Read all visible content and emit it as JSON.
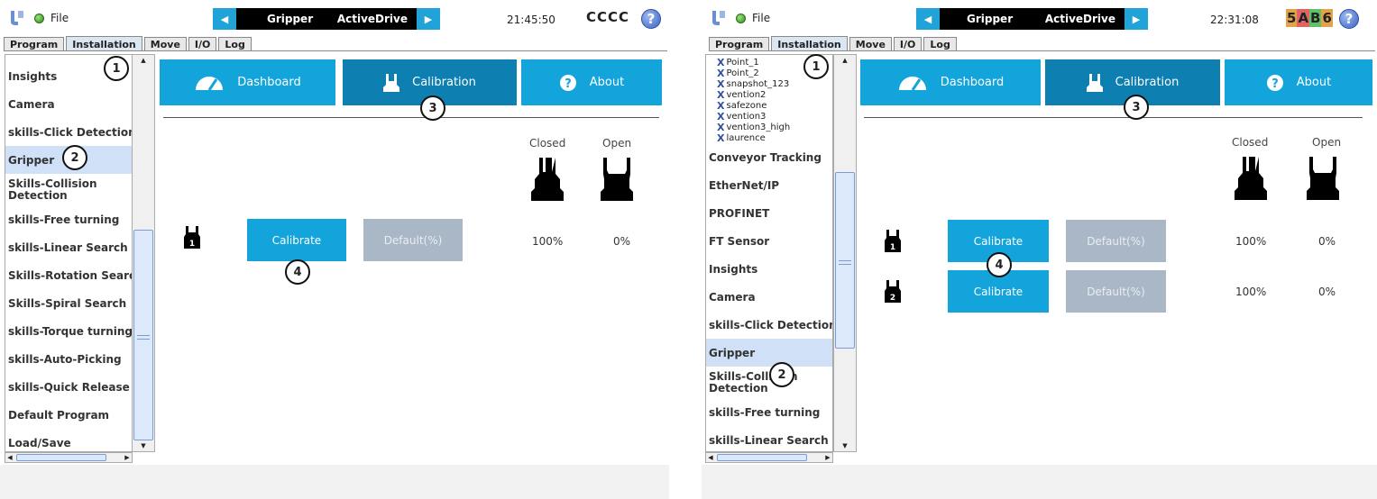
{
  "panels": [
    {
      "file_label": "File",
      "program_name": "Gripper",
      "mode_name": "ActiveDrive",
      "clock": "21:45:50",
      "robot_id": "CCCC",
      "robot_id_parts": [],
      "tabs": [
        "Program",
        "Installation",
        "Move",
        "I/O",
        "Log"
      ],
      "active_tab": "Installation",
      "tree_items": [],
      "sidebar_items": [
        "Insights",
        "Camera",
        "skills-Click Detection",
        "Gripper",
        "Skills-Collision Detection",
        "skills-Free turning",
        "skills-Linear Search",
        "Skills-Rotation Search",
        "Skills-Spiral Search",
        "skills-Torque turning",
        "skills-Auto-Picking",
        "skills-Quick Release",
        "Default Program",
        "Load/Save"
      ],
      "selected_sidebar": "Gripper",
      "buttons": {
        "dashboard": "Dashboard",
        "calibration": "Calibration",
        "about": "About"
      },
      "columns": {
        "closed": "Closed",
        "open": "Open"
      },
      "rows": [
        {
          "badge": "1",
          "calibrate": "Calibrate",
          "default": "Default(%)",
          "closed": "100%",
          "open": "0%"
        }
      ],
      "callouts": [
        "1",
        "2",
        "3",
        "4"
      ]
    },
    {
      "file_label": "File",
      "program_name": "Gripper",
      "mode_name": "ActiveDrive",
      "clock": "22:31:08",
      "robot_id": "",
      "robot_id_parts": [
        {
          "text": "5",
          "bg": "#e3a34a",
          "color": "#111"
        },
        {
          "text": "A",
          "bg": "#e06464",
          "color": "#111"
        },
        {
          "text": "B",
          "bg": "#5fc26a",
          "color": "#111"
        },
        {
          "text": "6",
          "bg": "#e3a34a",
          "color": "#111"
        }
      ],
      "tabs": [
        "Program",
        "Installation",
        "Move",
        "I/O",
        "Log"
      ],
      "active_tab": "Installation",
      "tree_items": [
        "Point_1",
        "Point_2",
        "snapshot_123",
        "vention2",
        "safezone",
        "vention3",
        "vention3_high",
        "laurence"
      ],
      "sidebar_items": [
        "Conveyor Tracking",
        "EtherNet/IP",
        "PROFINET",
        "FT Sensor",
        "Insights",
        "Camera",
        "skills-Click Detection",
        "Gripper",
        "Skills-Collision Detection",
        "skills-Free turning",
        "skills-Linear Search"
      ],
      "selected_sidebar": "Gripper",
      "buttons": {
        "dashboard": "Dashboard",
        "calibration": "Calibration",
        "about": "About"
      },
      "columns": {
        "closed": "Closed",
        "open": "Open"
      },
      "rows": [
        {
          "badge": "1",
          "calibrate": "Calibrate",
          "default": "Default(%)",
          "closed": "100%",
          "open": "0%"
        },
        {
          "badge": "2",
          "calibrate": "Calibrate",
          "default": "Default(%)",
          "closed": "100%",
          "open": "0%"
        }
      ],
      "callouts": [
        "1",
        "2",
        "3",
        "4"
      ]
    }
  ],
  "colors": {
    "accent": "#14a4dc",
    "active_button": "#0d7fb0",
    "disabled_button": "#a9b7c6",
    "selected_row": "#cfe0f7"
  },
  "icons": {
    "logo": "universal-robots-logo",
    "status": "status-dot-icon",
    "help": "help-icon",
    "dashboard": "speedometer-icon",
    "calibration": "gripper-icon",
    "about": "question-circle-icon"
  }
}
